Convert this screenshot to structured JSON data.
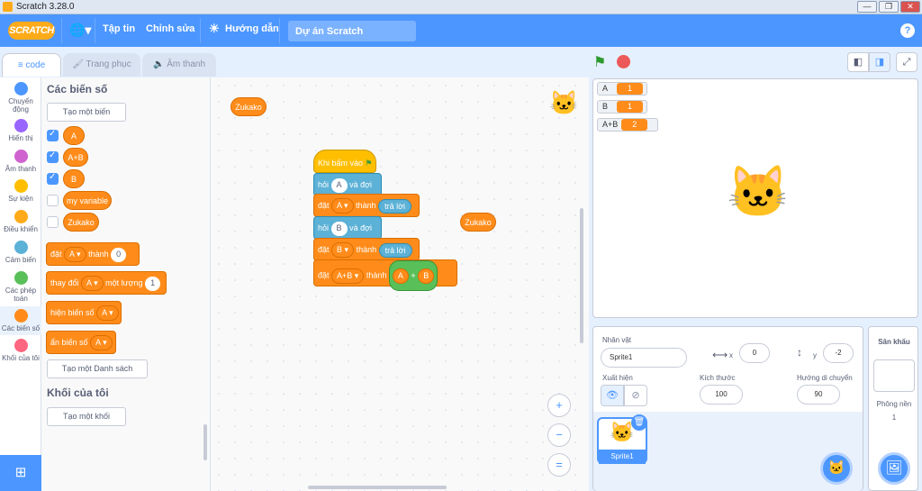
{
  "window": {
    "title": "Scratch 3.28.0",
    "controls": [
      "—",
      "❐",
      "✕"
    ]
  },
  "menubar": {
    "logo": "SCRATCH",
    "file": "Tập tin",
    "edit": "Chỉnh sửa",
    "tutorials": "Hướng dẫn",
    "project_name": "Dự án Scratch",
    "help": "?"
  },
  "tabs": {
    "code": "code",
    "costumes": "Trang phục",
    "sounds": "Âm thanh"
  },
  "categories": [
    {
      "label": "Chuyển động",
      "color": "#4c97ff"
    },
    {
      "label": "Hiển thị",
      "color": "#9966ff"
    },
    {
      "label": "Âm thanh",
      "color": "#cf63cf"
    },
    {
      "label": "Sự kiện",
      "color": "#ffbf00"
    },
    {
      "label": "Điều khiển",
      "color": "#ffab19"
    },
    {
      "label": "Cảm biến",
      "color": "#5cb1d6"
    },
    {
      "label": "Các phép toán",
      "color": "#59c059"
    },
    {
      "label": "Các biến số",
      "color": "#ff8c1a"
    },
    {
      "label": "Khối của tôi",
      "color": "#ff6680"
    }
  ],
  "palette": {
    "variables_heading": "Các biến số",
    "make_variable": "Tạo một biến",
    "variables": [
      {
        "name": "A",
        "checked": true
      },
      {
        "name": "A+B",
        "checked": true
      },
      {
        "name": "B",
        "checked": true
      },
      {
        "name": "my variable",
        "checked": false
      },
      {
        "name": "Zukako",
        "checked": false
      }
    ],
    "set_block": {
      "label": "đặt",
      "var": "A",
      "to": "thành",
      "value": "0"
    },
    "change_block": {
      "label": "thay đổi",
      "var": "A",
      "by": "một lượng",
      "value": "1"
    },
    "show_block": {
      "label": "hiện biến số",
      "var": "A"
    },
    "hide_block": {
      "label": "ẩn biến số",
      "var": "A"
    },
    "make_list": "Tạo một Danh sách",
    "myblocks_heading": "Khối của tôi",
    "make_block": "Tạo một khối"
  },
  "script": {
    "hat": "Khi bấm vào",
    "ask1": {
      "label": "hỏi",
      "value": "A",
      "tail": "và đợi"
    },
    "set1": {
      "label": "đặt",
      "var": "A",
      "to": "thành",
      "value": "trả lời"
    },
    "ask2": {
      "label": "hỏi",
      "value": "B",
      "tail": "và đợi"
    },
    "set2": {
      "label": "đặt",
      "var": "B",
      "to": "thành",
      "value": "trả lời"
    },
    "set3": {
      "label": "đặt",
      "var": "A+B",
      "to": "thành",
      "left": "A",
      "op": "+",
      "right": "B"
    },
    "loose_reporter_1": "Zukako",
    "loose_reporter_2": "Zukako"
  },
  "zoom": {
    "in": "+",
    "out": "−",
    "reset": "="
  },
  "monitors": [
    {
      "name": "A",
      "value": "1"
    },
    {
      "name": "B",
      "value": "1"
    },
    {
      "name": "A+B",
      "value": "2"
    }
  ],
  "sprite_info": {
    "sprite_label": "Nhân vật",
    "sprite_name": "Sprite1",
    "x_label": "x",
    "x": "0",
    "y_label": "y",
    "y": "-2",
    "show_label": "Xuất hiện",
    "size_label": "Kích thước",
    "size": "100",
    "direction_label": "Hướng di chuyển",
    "direction": "90"
  },
  "sprites": [
    {
      "name": "Sprite1"
    }
  ],
  "backdrop": {
    "heading": "Sân khấu",
    "count_label": "Phông nền",
    "count": "1"
  }
}
